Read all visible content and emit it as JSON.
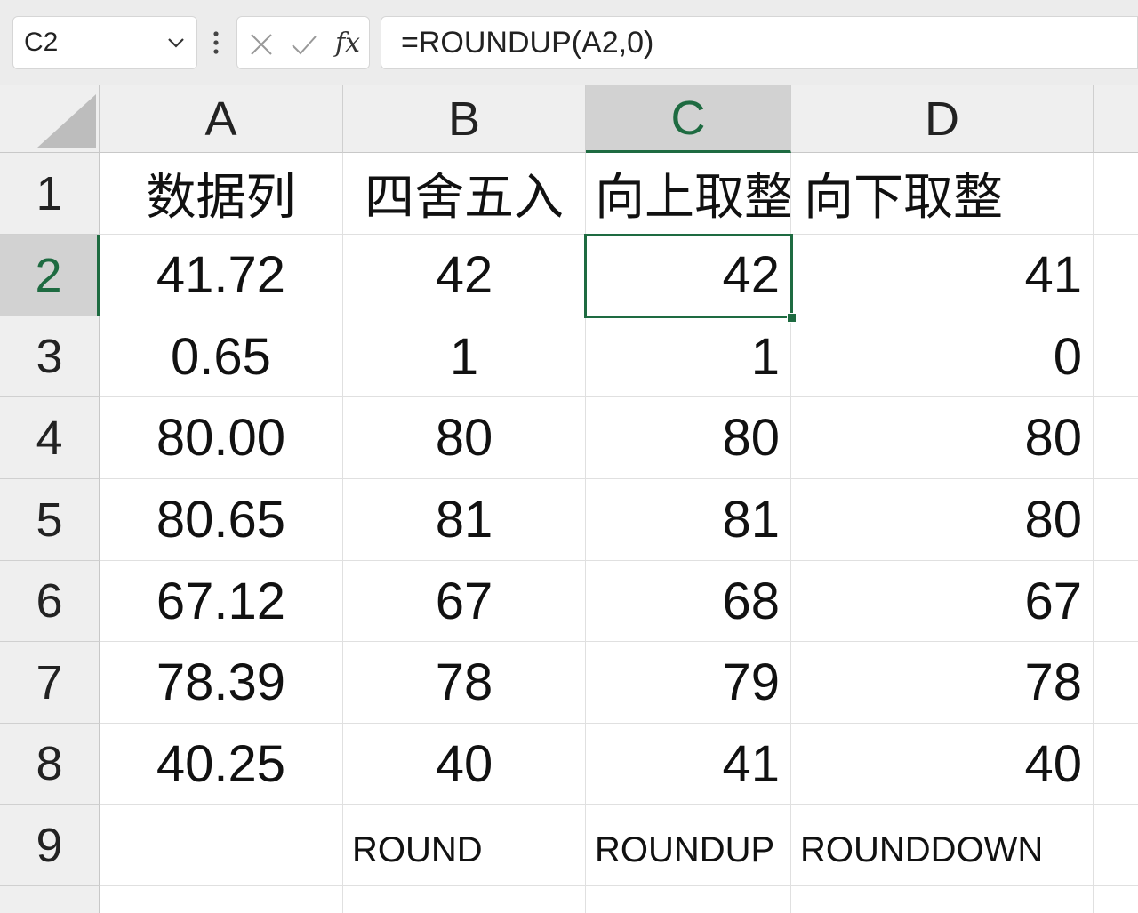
{
  "formula_bar": {
    "name_box": "C2",
    "formula": "=ROUNDUP(A2,0)",
    "fx_label": "fx"
  },
  "columns": [
    "A",
    "B",
    "C",
    "D"
  ],
  "rows": [
    "1",
    "2",
    "3",
    "4",
    "5",
    "6",
    "7",
    "8",
    "9"
  ],
  "selected_cell": "C2",
  "cells": {
    "r1": [
      "数据列",
      "四舍五入",
      "向上取整",
      "向下取整"
    ],
    "r2": [
      "41.72",
      "42",
      "42",
      "41"
    ],
    "r3": [
      "0.65",
      "1",
      "1",
      "0"
    ],
    "r4": [
      "80.00",
      "80",
      "80",
      "80"
    ],
    "r5": [
      "80.65",
      "81",
      "81",
      "80"
    ],
    "r6": [
      "67.12",
      "67",
      "68",
      "67"
    ],
    "r7": [
      "78.39",
      "78",
      "79",
      "78"
    ],
    "r8": [
      "40.25",
      "40",
      "41",
      "40"
    ],
    "r9": [
      "",
      "ROUND",
      "ROUNDUP",
      "ROUNDDOWN"
    ]
  },
  "colors": {
    "accent": "#1e6b41",
    "header_bg": "#efefef",
    "selected_header_bg": "#d2d2d2"
  }
}
